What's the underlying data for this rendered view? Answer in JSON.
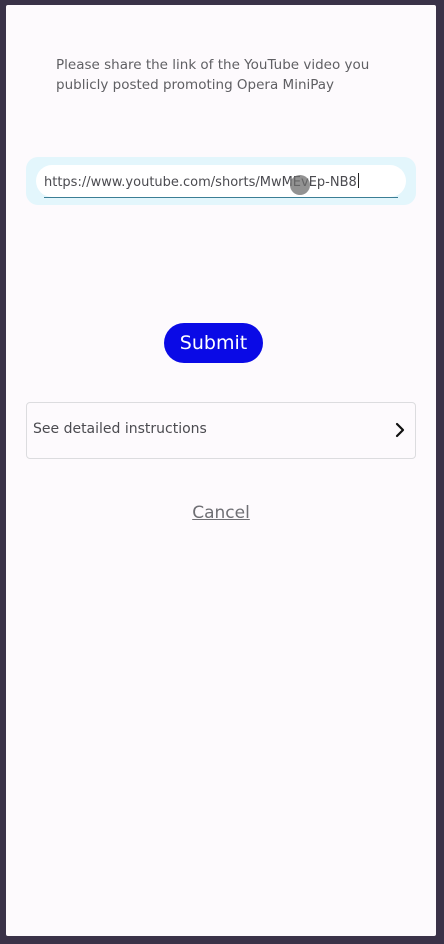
{
  "prompt": {
    "text": "Please share the link of the YouTube video you publicly posted promoting Opera MiniPay"
  },
  "link_input": {
    "value": "https://www.youtube.com/shorts/MwMEvEp-NB8"
  },
  "submit": {
    "label": "Submit"
  },
  "instructions": {
    "label": "See detailed instructions",
    "icon": "chevron-right-icon"
  },
  "cancel": {
    "label": "Cancel"
  },
  "colors": {
    "primary_button": "#0a0ae6",
    "input_highlight": "#e3f6fc",
    "frame": "#3a3248"
  }
}
